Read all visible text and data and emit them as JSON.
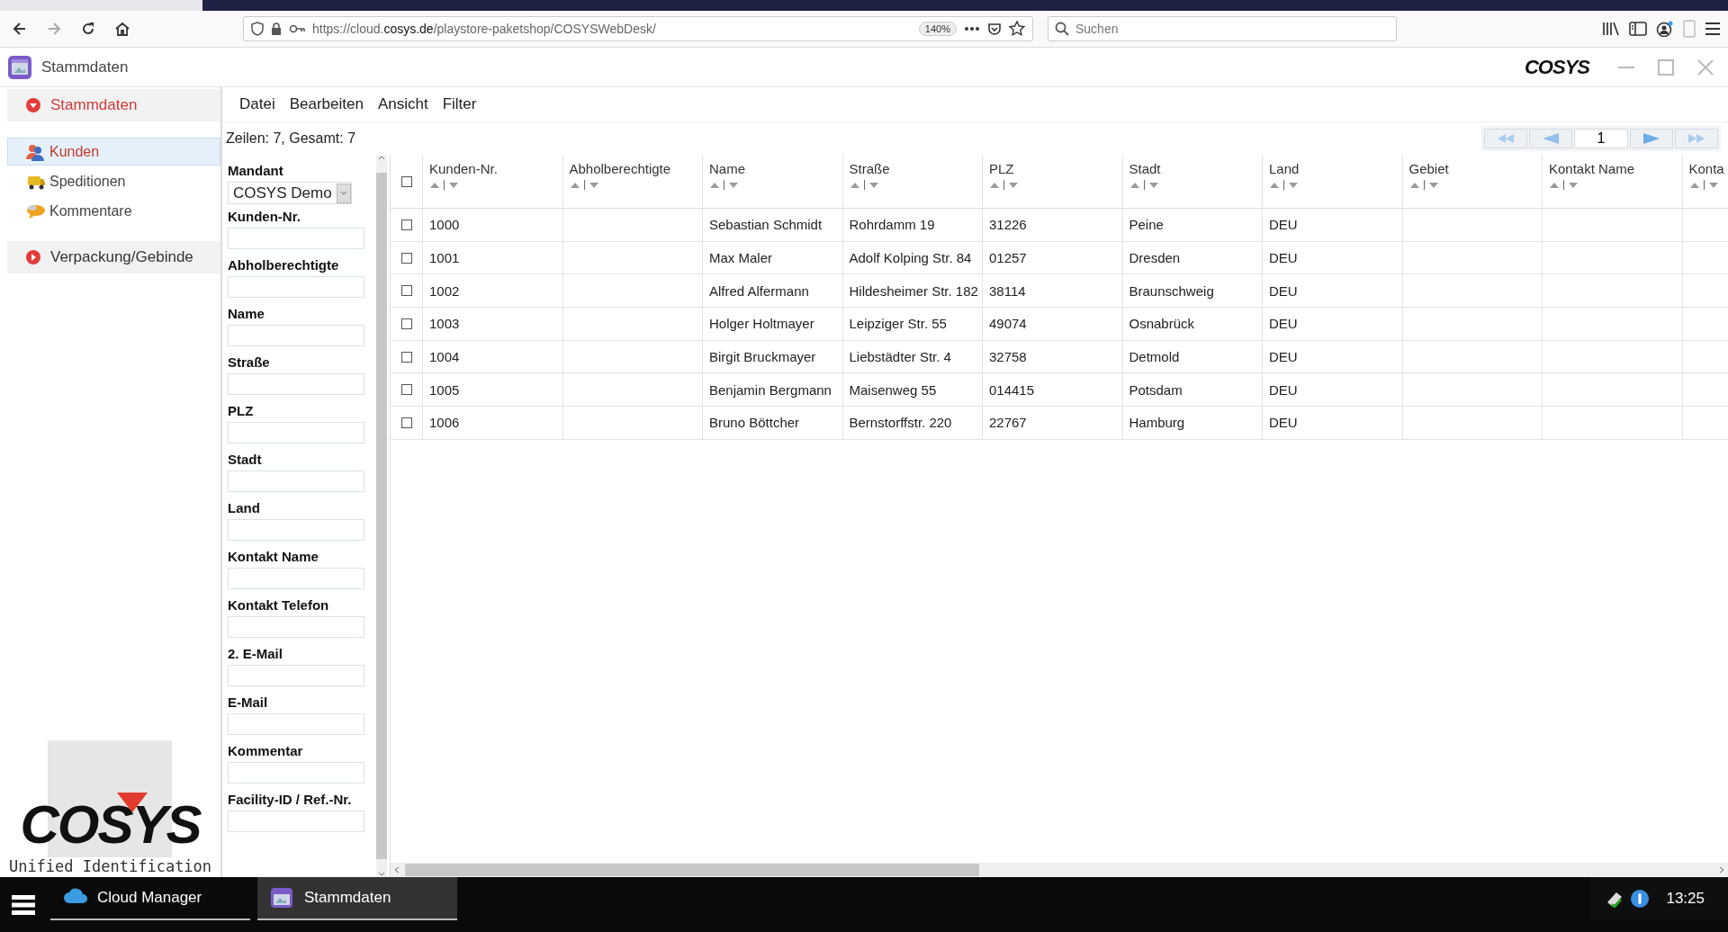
{
  "browser": {
    "url": "https://cloud.**cosys.de**/playstore-paketshop/COSYSWebDesk/",
    "zoom": "140%",
    "search": {
      "placeholder": "Suchen"
    }
  },
  "window": {
    "title": "Stammdaten",
    "logo": "COSYS"
  },
  "sidebar": {
    "groups": [
      {
        "label": "Stammdaten",
        "expanded": true,
        "items": [
          {
            "label": "Kunden",
            "selected": true,
            "kind": "customers"
          },
          {
            "label": "Speditionen",
            "selected": false,
            "kind": "truck"
          },
          {
            "label": "Kommentare",
            "selected": false,
            "kind": "comment"
          }
        ]
      },
      {
        "label": "Verpackung/Gebinde",
        "expanded": false
      }
    ]
  },
  "brand": {
    "logo": "COSYS",
    "tagline": "Unified Identification"
  },
  "menu": [
    "Datei",
    "Bearbeiten",
    "Ansicht",
    "Filter"
  ],
  "row_count": "Zeilen: 7, Gesamt: 7",
  "pager": {
    "page": "1"
  },
  "filters": {
    "mandant": {
      "label": "Mandant",
      "value": "COSYS Demo"
    },
    "fields": [
      "Kunden-Nr.",
      "Abholberechtigte",
      "Name",
      "Straße",
      "PLZ",
      "Stadt",
      "Land",
      "Kontakt Name",
      "Kontakt Telefon",
      "2. E-Mail",
      "E-Mail",
      "Kommentar",
      "Facility-ID / Ref.-Nr."
    ]
  },
  "table": {
    "select_all": {
      "checked": false
    },
    "columns": [
      "Kunden-Nr.",
      "Abholberechtigte",
      "Name",
      "Straße",
      "PLZ",
      "Stadt",
      "Land",
      "Gebiet",
      "Kontakt Name",
      "Konta"
    ],
    "rows": [
      {
        "checked": false,
        "cells": [
          "1000",
          null,
          "Sebastian Schmidt",
          "Rohrdamm 19",
          "31226",
          "Peine",
          "DEU"
        ]
      },
      {
        "checked": false,
        "cells": [
          "1001",
          null,
          "Max Maler",
          "Adolf Kolping Str. 84",
          "01257",
          "Dresden",
          "DEU"
        ]
      },
      {
        "checked": false,
        "cells": [
          "1002",
          null,
          "Alfred Alfermann",
          "Hildesheimer Str. 182",
          "38114",
          "Braunschweig",
          "DEU"
        ]
      },
      {
        "checked": false,
        "cells": [
          "1003",
          null,
          "Holger Holtmayer",
          "Leipziger Str. 55",
          "49074",
          "Osnabrück",
          "DEU"
        ]
      },
      {
        "checked": false,
        "cells": [
          "1004",
          null,
          "Birgit Bruckmayer",
          "Liebstädter Str. 4",
          "32758",
          "Detmold",
          "DEU"
        ]
      },
      {
        "checked": false,
        "cells": [
          "1005",
          null,
          "Benjamin Bergmann",
          "Maisenweg 55",
          "014415",
          "Potsdam",
          "DEU"
        ]
      },
      {
        "checked": false,
        "cells": [
          "1006",
          null,
          "Bruno Böttcher",
          "Bernstorffstr. 220",
          "22767",
          "Hamburg",
          "DEU"
        ]
      }
    ]
  },
  "taskbar": {
    "apps": [
      {
        "label": "Cloud Manager",
        "selected": false,
        "kind": "cloud"
      },
      {
        "label": "Stammdaten",
        "selected": true,
        "kind": "app"
      }
    ],
    "clock": "13:25"
  }
}
